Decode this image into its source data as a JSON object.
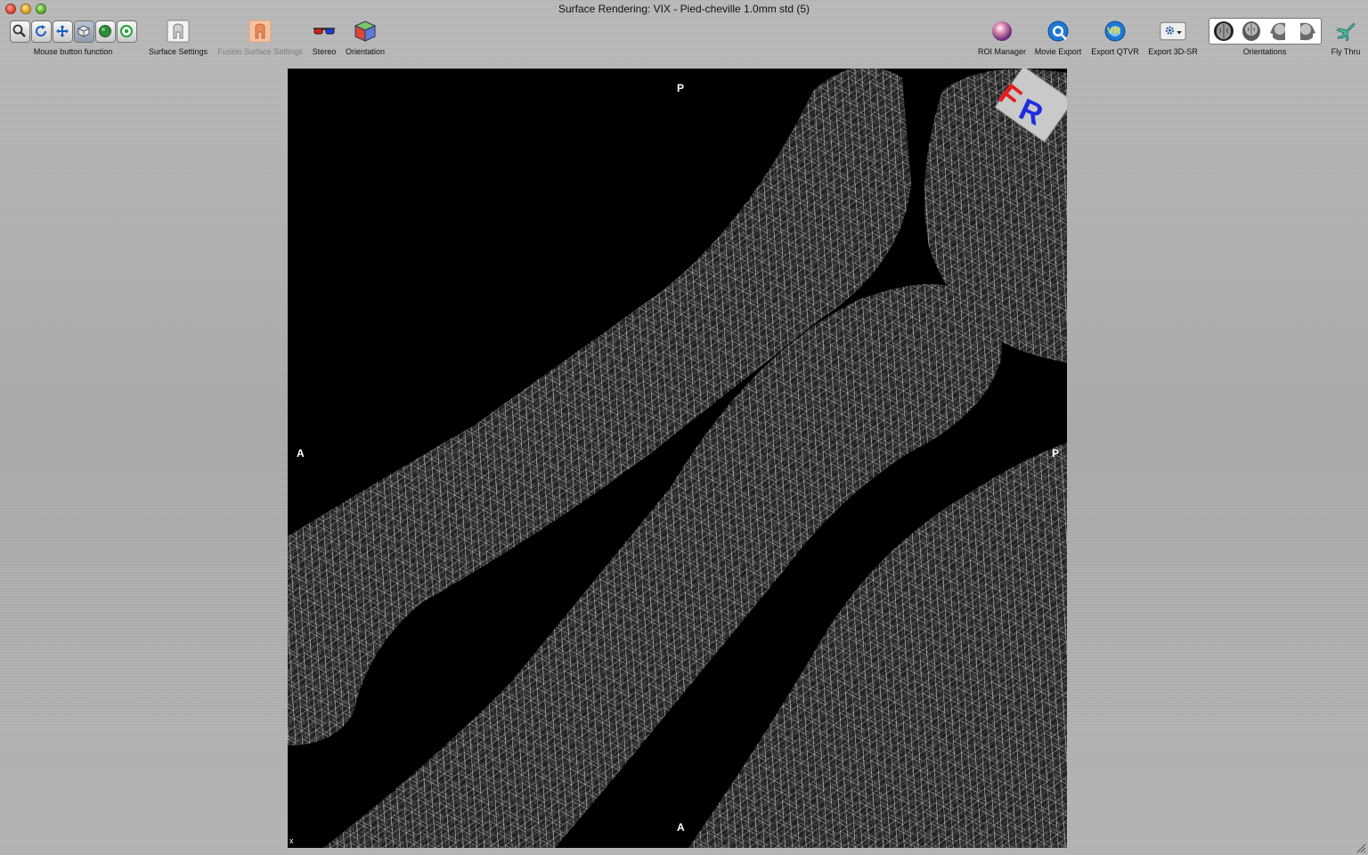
{
  "window": {
    "title": "Surface Rendering: VIX - Pied-cheville  1.0mm std (5)"
  },
  "toolbar": {
    "mouse_button_function_label": "Mouse button function",
    "mouse_tools": [
      "zoom-icon",
      "rotate-icon",
      "pan-icon",
      "3d-rotate-icon",
      "wl-icon",
      "crop-icon"
    ],
    "surface_settings_label": "Surface Settings",
    "fusion_surface_settings_label": "Fusion Surface Settings",
    "stereo_label": "Stereo",
    "orientation_label": "Orientation",
    "roi_manager_label": "ROI Manager",
    "movie_export_label": "Movie Export",
    "export_qtvr_label": "Export QTVR",
    "export_qtvr_badge": "VR",
    "export_3dsr_label": "Export 3D-SR",
    "orientations_label": "Orientations",
    "fly_thru_label": "Fly Thru"
  },
  "viewport": {
    "top_label": "P",
    "left_label": "A",
    "right_label": "P",
    "bottom_label": "A",
    "corner_label": "x",
    "cube_letters": [
      "F",
      "R"
    ]
  },
  "colors": {
    "cube_red": "#e02020",
    "cube_blue": "#1f2de0",
    "mesh": "#d8d8d8"
  }
}
